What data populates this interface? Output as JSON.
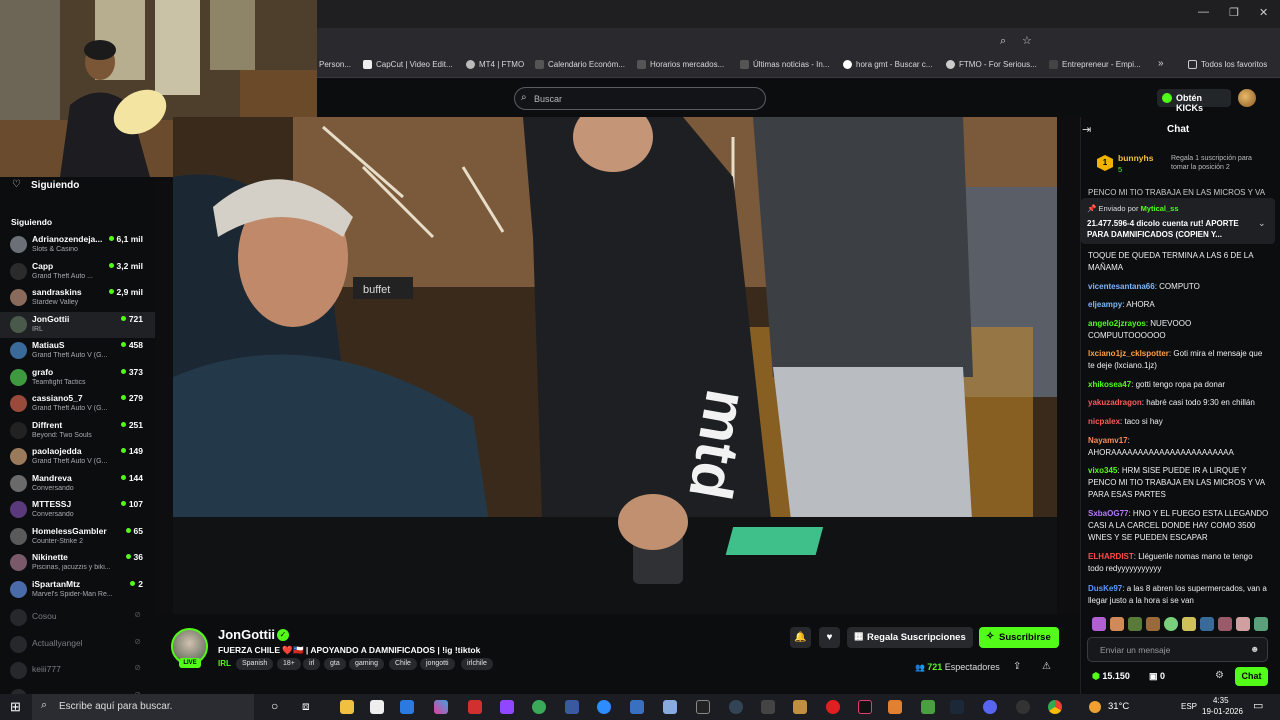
{
  "bookmarks": [
    {
      "label": "Person..."
    },
    {
      "label": "CapCut | Video Edit..."
    },
    {
      "label": "MT4 | FTMO"
    },
    {
      "label": "Calendario Económ..."
    },
    {
      "label": "Horarios mercados..."
    },
    {
      "label": "Últimas noticias - In..."
    },
    {
      "label": "hora gmt - Buscar c..."
    },
    {
      "label": "FTMO - For Serious..."
    },
    {
      "label": "Entrepreneur - Empi..."
    },
    {
      "label": "»"
    },
    {
      "label": "Todos los favoritos"
    }
  ],
  "header": {
    "search_placeholder": "Buscar",
    "kicks_label": "Obtén KICKs"
  },
  "sidebar": {
    "top_label": "Siguiendo",
    "section_label": "Siguiendo",
    "items": [
      {
        "name": "Adrianozendeja...",
        "game": "Slots & Casino",
        "count": "6,1 mil",
        "color": "#6b6f78"
      },
      {
        "name": "Capp",
        "game": "Grand Theft Auto ...",
        "count": "3,2 mil",
        "color": "#2b2b2b"
      },
      {
        "name": "sandraskins",
        "game": "Stardew Valley",
        "count": "2,9 mil",
        "color": "#8a6a5a"
      },
      {
        "name": "JonGottii",
        "game": "IRL",
        "count": "721",
        "color": "#4a5a4a"
      },
      {
        "name": "MatiauS",
        "game": "Grand Theft Auto V (G...",
        "count": "458",
        "color": "#3a6a9a"
      },
      {
        "name": "grafo",
        "game": "Teamfight Tactics",
        "count": "373",
        "color": "#3f9a3f"
      },
      {
        "name": "cassiano5_7",
        "game": "Grand Theft Auto V (G...",
        "count": "279",
        "color": "#9a4a3a"
      },
      {
        "name": "Diffrent",
        "game": "Beyond: Two Souls",
        "count": "251",
        "color": "#222"
      },
      {
        "name": "paolaojedda",
        "game": "Grand Theft Auto V (G...",
        "count": "149",
        "color": "#9a7a5a"
      },
      {
        "name": "Mandreva",
        "game": "Conversando",
        "count": "144",
        "color": "#6a6a6a"
      },
      {
        "name": "MTTESSJ",
        "game": "Conversando",
        "count": "107",
        "color": "#5a3a7a"
      },
      {
        "name": "HomelessGambler69",
        "game": "Counter-Strike 2",
        "count": "65",
        "color": "#5a5a5a"
      },
      {
        "name": "Nikinette",
        "game": "Piscinas, jacuzzis y biki...",
        "count": "36",
        "color": "#7a5a6a"
      },
      {
        "name": "iSpartanMtz",
        "game": "Marvel's Spider-Man Re...",
        "count": "2",
        "color": "#4a6aaa"
      }
    ],
    "offline": [
      {
        "name": "Cosou"
      },
      {
        "name": "Actuallyangel"
      },
      {
        "name": "keiii777"
      },
      {
        "name": "..."
      }
    ]
  },
  "stream": {
    "channel": "JonGottii",
    "live_badge": "LIVE",
    "title": "FUERZA CHILE ❤️🇨🇱 | APOYANDO A DAMNIFICADOS | !ig !tiktok",
    "category": "IRL",
    "tags": [
      "Spanish",
      "18+",
      "irl",
      "gta",
      "gaming",
      "Chile",
      "jongotti",
      "irlchile"
    ],
    "gift_label": "Regala Suscripciones",
    "subscribe_label": "Suscribirse",
    "viewers": "721",
    "viewers_label": "Espectadores"
  },
  "video": {
    "sign_text": "buffet"
  },
  "chat": {
    "title": "Chat",
    "top_gifter": {
      "name": "bunnyhs",
      "count": "5",
      "note": "Regala 1 suscripción para tomar la posición 2"
    },
    "pinned": {
      "prefix": "Enviado por",
      "sender": "Mytical_ss",
      "text": "21.477.596-4 dicolo cuenta rut! APORTE PARA DAMNIFICADOS (COPIEN Y..."
    },
    "cut_top": "PENCO MI TIO TRABAJA EN LAS MICROS Y VA",
    "messages": [
      {
        "user": "",
        "text": "TOQUE DE QUEDA TERMINA A LAS 6 DE LA MAÑAMA",
        "color": "#efeff1"
      },
      {
        "user": "vicentesantana66",
        "text": "COMPUTO",
        "color": "#7ab8ff"
      },
      {
        "user": "eljeampy",
        "text": "AHORA",
        "color": "#7ab8ff"
      },
      {
        "user": "angelo2jzrayos",
        "text": "NUEVOOO COMPUUTOOOOOO",
        "color": "#53fc18"
      },
      {
        "user": "lxciano1jz_cklspotter",
        "text": "Goti mira el mensaje que te deje (lxciano.1jz)",
        "color": "#ff9f43"
      },
      {
        "user": "xhikosea47",
        "text": "gotti tengo ropa pa donar",
        "color": "#53fc18"
      },
      {
        "user": "yakuzadragon",
        "text": "habré casi todo 9:30 en chillán",
        "color": "#ff5a5a"
      },
      {
        "user": "nicpalex",
        "text": "taco si hay",
        "color": "#ff5a5a"
      },
      {
        "user": "Nayamv17",
        "text": "AHORAAAAAAAAAAAAAAAAAAAAAAA",
        "color": "#ff8a5a"
      },
      {
        "user": "vixo345",
        "text": "HRM SISE PUEDE IR A LIRQUE Y PENCO MI TIO TRABAJA EN LAS MICROS Y VA PARA ESAS PARTES",
        "color": "#53fc18"
      },
      {
        "user": "SxbaOG77",
        "text": "HNO Y EL FUEGO ESTA LLEGANDO CASI A LA CARCEL DONDE HAY COMO 3500 WNES Y SE PUEDEN ESCAPAR",
        "color": "#b87aff"
      },
      {
        "user": "ELHARDIST",
        "text": "Lléguenle nomas mano te tengo todo redyyyyyyyyyyy",
        "color": "#ff4a4a"
      },
      {
        "user": "DusKe97",
        "text": "a las 8 abren los supermercados, van a llegar justo a la hora si se van",
        "color": "#5a9aff"
      }
    ],
    "input_placeholder": "Enviar un mensaje",
    "points": "15.150",
    "points2": "0",
    "send_label": "Chat"
  },
  "taskbar": {
    "search_placeholder": "Escribe aquí para buscar.",
    "weather": "31°C",
    "lang": "ESP",
    "time": "4:35",
    "date": "19-01-2026"
  },
  "colors": {
    "accent": "#53fc18",
    "bg": "#0b0d0f"
  }
}
